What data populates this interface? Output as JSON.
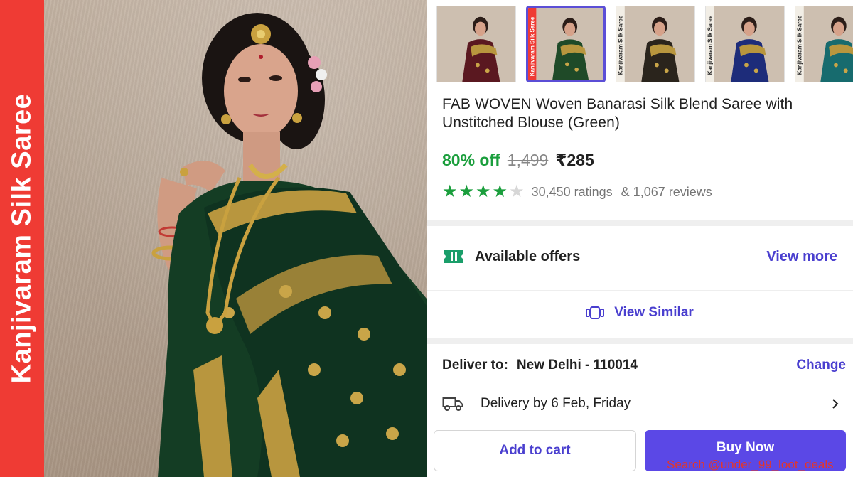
{
  "banner": {
    "text": "Kanjivaram Silk Saree"
  },
  "product": {
    "title": "FAB WOVEN Woven Banarasi Silk Blend Saree with Unstitched Blouse (Green)",
    "discount": "80% off",
    "mrp": "1,499",
    "price": "₹285",
    "rating_stars": 4,
    "rating_max": 5,
    "ratings_count": "30,450 ratings",
    "reviews_count": "& 1,067 reviews"
  },
  "thumbnails": [
    {
      "label": "",
      "saree_color": "#5a1820",
      "selected": false
    },
    {
      "label": "Kanjivaram Silk Saree",
      "saree_color": "#1f4a28",
      "selected": true
    },
    {
      "label": "Kanjivaram Silk Saree",
      "saree_color": "#2a241c",
      "selected": false
    },
    {
      "label": "Kanjivaram Silk Saree",
      "saree_color": "#1d2c7a",
      "selected": false
    },
    {
      "label": "Kanjivaram Silk Saree",
      "saree_color": "#176b6e",
      "selected": false
    }
  ],
  "offers": {
    "title": "Available offers",
    "view_more": "View more",
    "icon": "ticket-icon"
  },
  "similar": {
    "label": "View Similar",
    "icon": "similar-cards-icon"
  },
  "delivery": {
    "deliver_label": "Deliver to:",
    "place": "New Delhi - 110014",
    "change": "Change",
    "eta": "Delivery by 6 Feb, Friday",
    "icon": "truck-icon"
  },
  "actions": {
    "add_to_cart": "Add to cart",
    "buy_now": "Buy Now"
  },
  "watermark": "Search @under_99_loot_deals",
  "colors": {
    "accent": "#4a3fcf",
    "buy_button": "#5b48e6",
    "discount_green": "#1a9e3c",
    "banner_red": "#ef3b34",
    "saree_green": "#123d22",
    "zari_gold": "#b8963e"
  }
}
